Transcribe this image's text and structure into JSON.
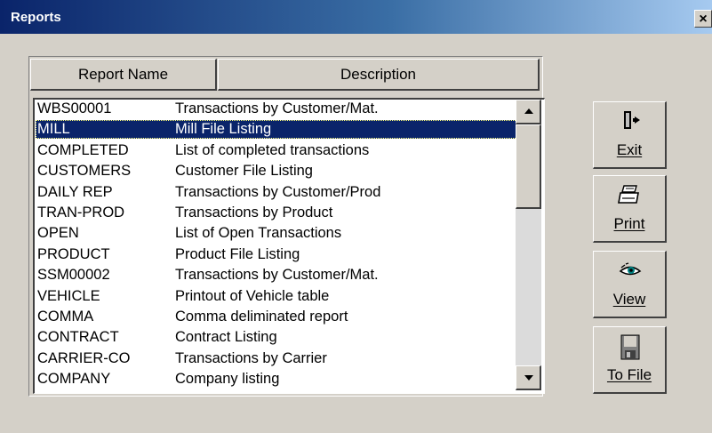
{
  "window": {
    "title": "Reports",
    "close_glyph": "×"
  },
  "columns": {
    "name": "Report Name",
    "description": "Description"
  },
  "reports": [
    {
      "name": "WBS00001",
      "description": "Transactions by Customer/Mat."
    },
    {
      "name": "MILL",
      "description": "Mill File Listing",
      "selected": true
    },
    {
      "name": "COMPLETED",
      "description": "List of completed transactions"
    },
    {
      "name": "CUSTOMERS",
      "description": "Customer File Listing"
    },
    {
      "name": "DAILY REP",
      "description": "Transactions by Customer/Prod"
    },
    {
      "name": "TRAN-PROD",
      "description": "Transactions by Product"
    },
    {
      "name": "OPEN",
      "description": "List of Open Transactions"
    },
    {
      "name": "PRODUCT",
      "description": "Product File Listing"
    },
    {
      "name": "SSM00002",
      "description": "Transactions by Customer/Mat."
    },
    {
      "name": "VEHICLE",
      "description": "Printout of Vehicle table"
    },
    {
      "name": "COMMA",
      "description": "Comma deliminated report"
    },
    {
      "name": "CONTRACT",
      "description": "Contract Listing"
    },
    {
      "name": "CARRIER-CO",
      "description": "Transactions by Carrier"
    },
    {
      "name": "COMPANY",
      "description": "Company listing"
    }
  ],
  "buttons": {
    "exit": "Exit",
    "print": "Print",
    "view": "View",
    "to_file": "To File"
  },
  "icons": {
    "exit": "door-exit-icon",
    "print": "printer-icon",
    "view": "eye-icon",
    "to_file": "floppy-disk-icon"
  },
  "colors": {
    "title_gradient_start": "#0a246a",
    "title_gradient_end": "#a6caf0",
    "selection": "#0a246a",
    "face": "#d4d0c8"
  }
}
